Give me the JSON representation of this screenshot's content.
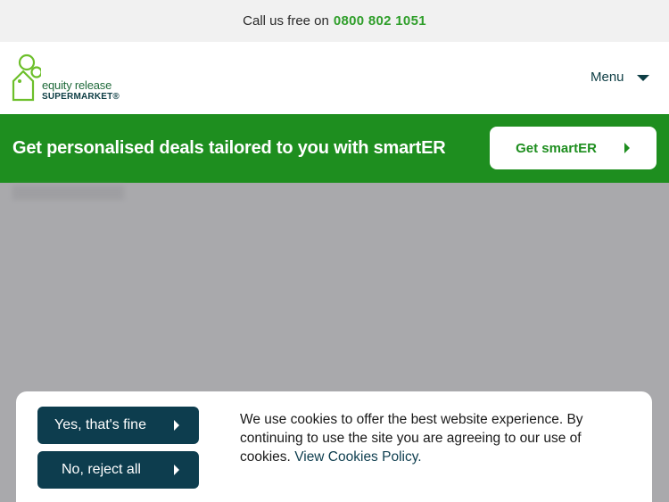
{
  "topbar": {
    "call_text": "Call us free on",
    "phone": "0800 802 1051"
  },
  "header": {
    "logo_line1": "equity release",
    "logo_line2": "SUPERMARKET®",
    "menu_label": "Menu"
  },
  "promo": {
    "text": "Get personalised deals tailored to you with smartER",
    "button_label": "Get smartER"
  },
  "cookie": {
    "accept_label": "Yes, that's fine",
    "reject_label": "No, reject all",
    "message": "We use cookies to offer the best website experience. By continuing to use the site you are agreeing to our use of cookies.",
    "policy_link": "View Cookies Policy."
  },
  "colors": {
    "brand_green": "#1e8e1f",
    "dark_teal": "#0d3d4e",
    "phone_green": "#2f9e2a"
  }
}
